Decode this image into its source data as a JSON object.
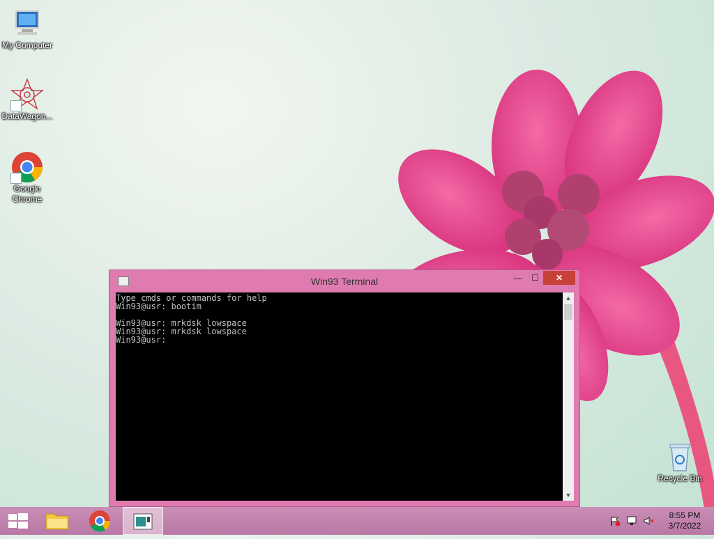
{
  "desktop": {
    "icons": [
      {
        "label": "My Computer"
      },
      {
        "label": "DataWagon..."
      },
      {
        "label": "Google Chrome"
      },
      {
        "label": "Recycle Bin"
      }
    ]
  },
  "terminal": {
    "title": "Win93 Terminal",
    "lines": [
      "Type cmds or commands for help",
      "Win93@usr: bootim",
      "",
      "Win93@usr: mrkdsk lowspace",
      "Win93@usr: mrkdsk lowspace",
      "Win93@usr: "
    ],
    "buttons": {
      "min": "—",
      "max": "☐",
      "close": "✕"
    }
  },
  "taskbar": {
    "clock_time": "8:55 PM",
    "clock_date": "3/7/2022"
  },
  "colors": {
    "window_frame": "#e07bb0",
    "close_button": "#c7403a",
    "taskbar": "#c98eb6"
  }
}
